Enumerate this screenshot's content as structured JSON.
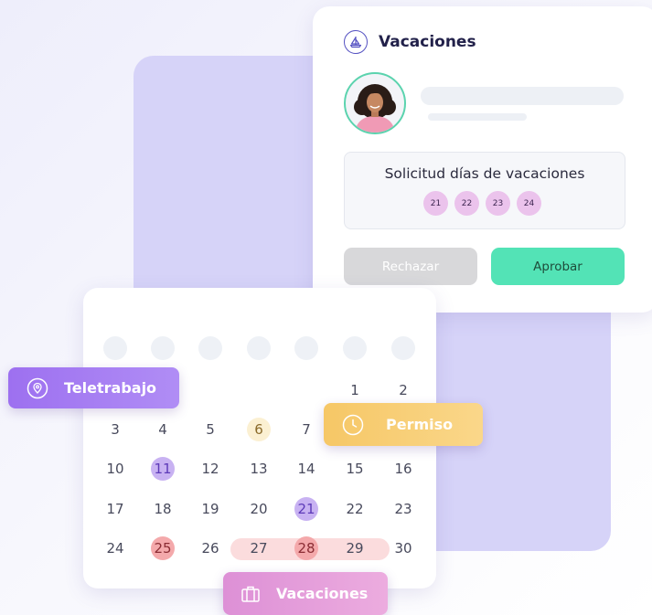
{
  "request_card": {
    "title": "Vacaciones",
    "icon": "sailboat-icon",
    "request_label": "Solicitud días de vacaciones",
    "requested_days": [
      "21",
      "22",
      "23",
      "24"
    ],
    "reject_label": "Rechazar",
    "approve_label": "Aprobar"
  },
  "calendar": {
    "rows": [
      [
        "",
        "",
        "",
        "",
        "",
        "1",
        "2"
      ],
      [
        "3",
        "4",
        "5",
        "6",
        "7",
        "",
        ""
      ],
      [
        "10",
        "11",
        "12",
        "13",
        "14",
        "15",
        "16"
      ],
      [
        "17",
        "18",
        "19",
        "20",
        "21",
        "22",
        "23"
      ],
      [
        "24",
        "25",
        "26",
        "27",
        "28",
        "29",
        "30"
      ]
    ],
    "highlighted_days": {
      "teletrabajo": [
        "11",
        "21"
      ],
      "permiso": [
        "6"
      ],
      "vacaciones": [
        "25",
        "26",
        "27",
        "28"
      ]
    }
  },
  "tags": {
    "teletrabajo": {
      "label": "Teletrabajo",
      "icon": "location-pin-icon"
    },
    "permiso": {
      "label": "Permiso",
      "icon": "clock-icon"
    },
    "vacaciones": {
      "label": "Vacaciones",
      "icon": "suitcase-icon"
    }
  },
  "colors": {
    "teletrabajo": "#b08df5",
    "permiso": "#f6c766",
    "vacaciones": "#dd90d6",
    "approve": "#53e3b6",
    "reject": "#d8d8da"
  }
}
